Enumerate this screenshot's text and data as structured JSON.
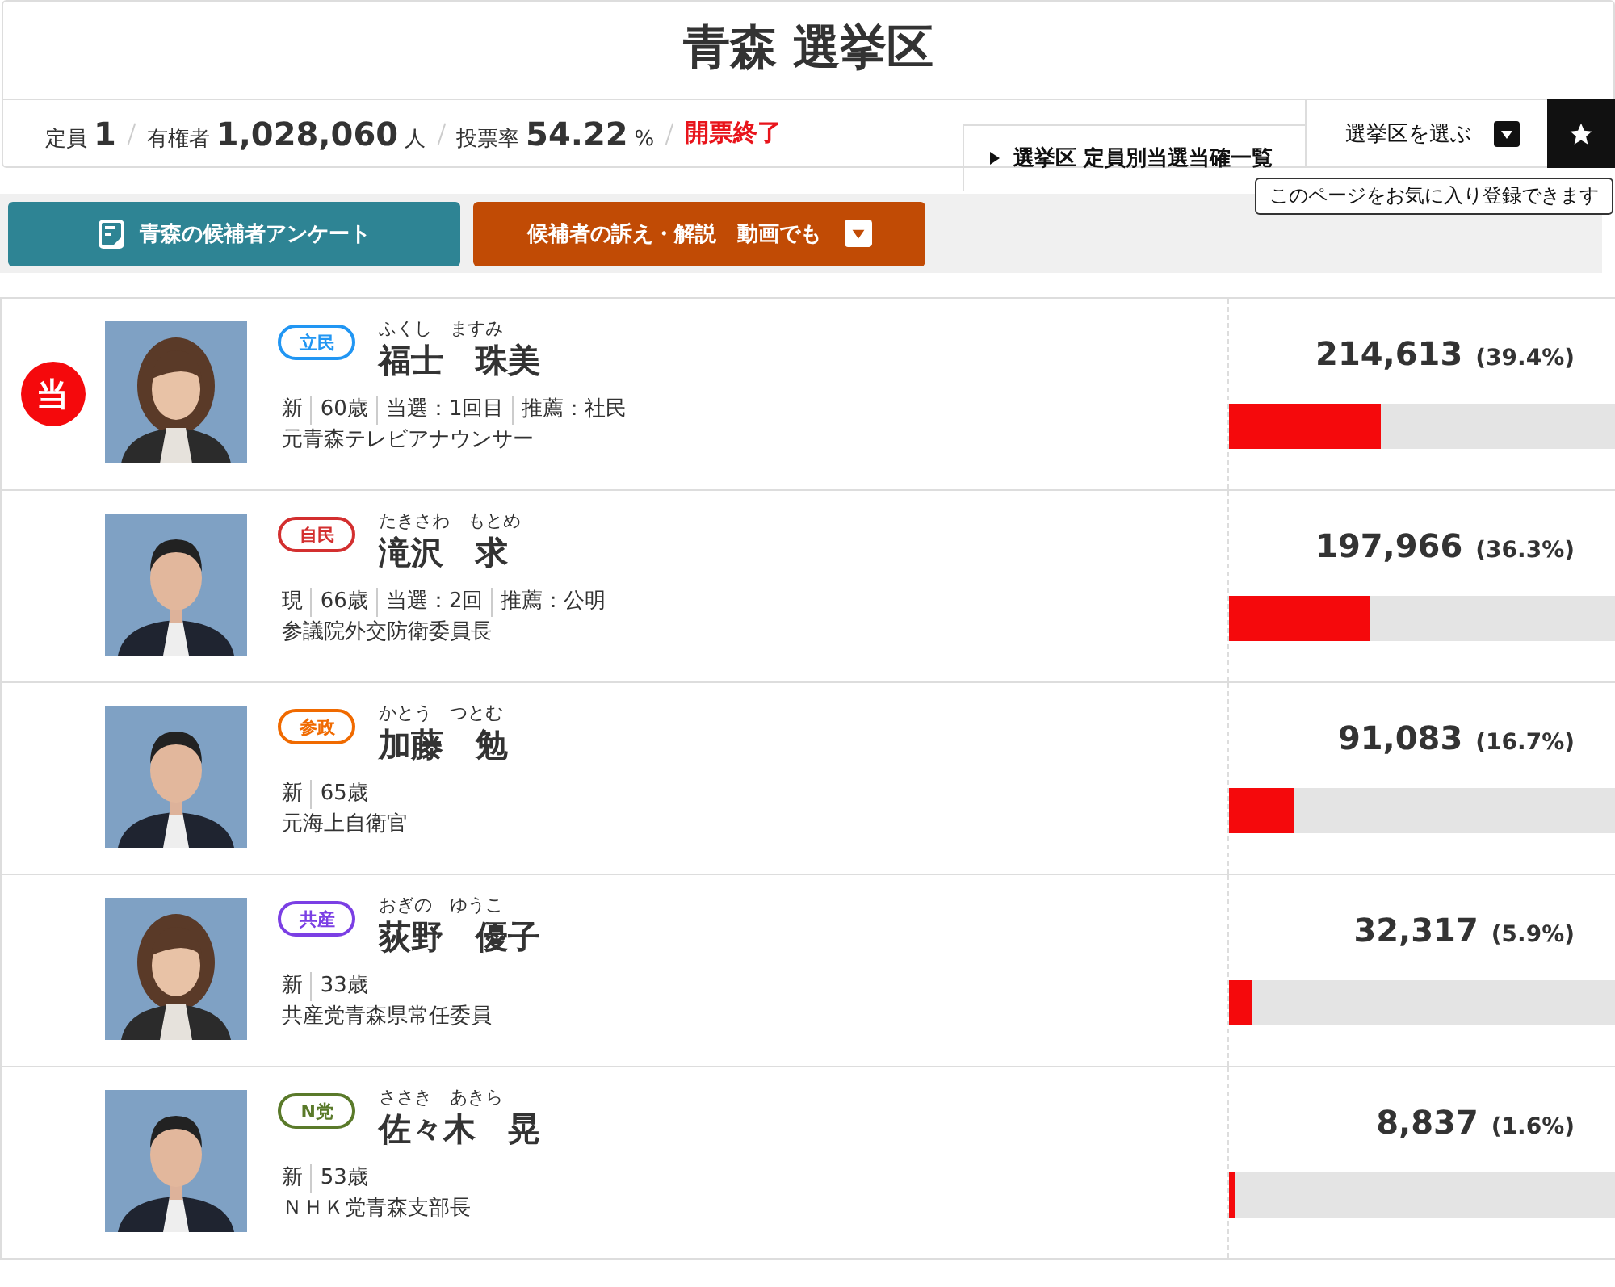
{
  "title": "青森 選挙区",
  "stats": [
    {
      "label": "定員",
      "value": "1"
    },
    {
      "label": "有権者",
      "value": "1,028,060",
      "unit": "人"
    },
    {
      "label": "投票率",
      "value": "54.22",
      "unit": "%"
    }
  ],
  "count_status": "開票終了",
  "header_links": [
    {
      "kind": "list",
      "label": "選挙区 定員別当選当確一覧"
    },
    {
      "kind": "dropdown",
      "label": "選挙区を選ぶ"
    }
  ],
  "favorite_tooltip": "このページをお気に入り登録できます",
  "action_buttons": [
    {
      "kind": "survey",
      "label": "青森の候補者アンケート"
    },
    {
      "kind": "video",
      "label": "候補者の訴え・解説　動画でも"
    }
  ],
  "elected_label": "当",
  "candidates": [
    {
      "elected": true,
      "party": "立民",
      "color": "#2196f3",
      "kana": "ふくし　ますみ",
      "name": "福士　珠美",
      "details": [
        "新",
        "60歳",
        "当選：1回目",
        "推薦：社民"
      ],
      "career": "元青森テレビアナウンサー",
      "votes": "214,613",
      "share": "(39.4%)",
      "level": 0.394
    },
    {
      "elected": false,
      "party": "自民",
      "color": "#d32f2f",
      "kana": "たきさわ　もとめ",
      "name": "滝沢　求",
      "details": [
        "現",
        "66歳",
        "当選：2回",
        "推薦：公明"
      ],
      "career": "参議院外交防衛委員長",
      "votes": "197,966",
      "share": "(36.3%)",
      "level": 0.363
    },
    {
      "elected": false,
      "party": "参政",
      "color": "#f06a00",
      "kana": "かとう　つとむ",
      "name": "加藤　勉",
      "details": [
        "新",
        "65歳"
      ],
      "career": "元海上自衛官",
      "votes": "91,083",
      "share": "(16.7%)",
      "level": 0.167
    },
    {
      "elected": false,
      "party": "共産",
      "color": "#7b3fe4",
      "kana": "おぎの　ゆうこ",
      "name": "荻野　優子",
      "details": [
        "新",
        "33歳"
      ],
      "career": "共産党青森県常任委員",
      "votes": "32,317",
      "share": "(5.9%)",
      "level": 0.059
    },
    {
      "elected": false,
      "party": "N党",
      "color": "#5a7a2a",
      "kana": "ささき　あきら",
      "name": "佐々木　晃",
      "details": [
        "新",
        "53歳"
      ],
      "career": "ＮＨＫ党青森支部長",
      "votes": "8,837",
      "share": "(1.6%)",
      "level": 0.016
    }
  ]
}
